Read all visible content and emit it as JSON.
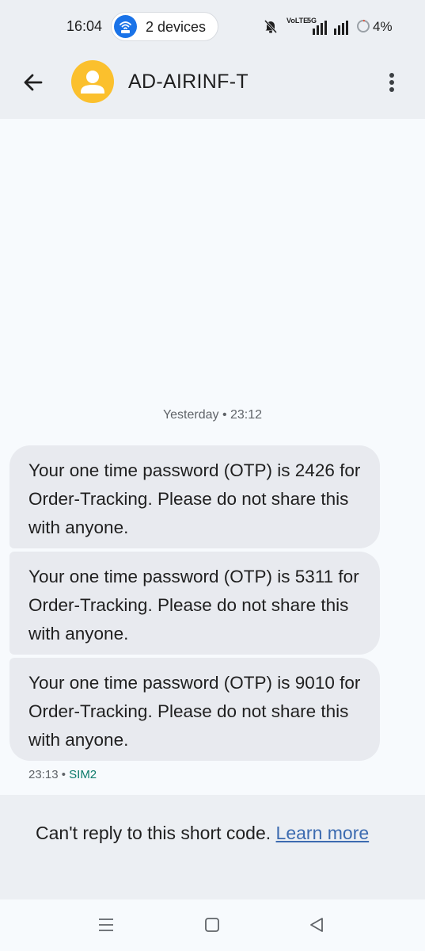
{
  "status_bar": {
    "time": "16:04",
    "hotspot_label": "2 devices",
    "volte_label": "VoLTE",
    "network_label": "5G",
    "battery": "4%"
  },
  "app_bar": {
    "contact_name": "AD-AIRINF-T"
  },
  "conversation": {
    "date_divider": "Yesterday • 23:12",
    "messages": [
      {
        "text": "Your one time password (OTP) is 2426 for Order-Tracking. Please do not share this with anyone."
      },
      {
        "text": "Your one time password (OTP) is 5311 for Order-Tracking. Please do not share this with anyone."
      },
      {
        "text": "Your one time password (OTP) is 9010 for Order-Tracking. Please do not share this with anyone."
      }
    ],
    "last_time": "23:13",
    "separator": " • ",
    "sim": "SIM2"
  },
  "reply_notice": {
    "text": "Can't reply to this short code. ",
    "link": "Learn more"
  },
  "colors": {
    "accent": "#1a73e8",
    "avatar": "#fbc02d",
    "bubble": "#e8eaef",
    "sim": "#0b7a6a",
    "link": "#3c6bb0"
  }
}
